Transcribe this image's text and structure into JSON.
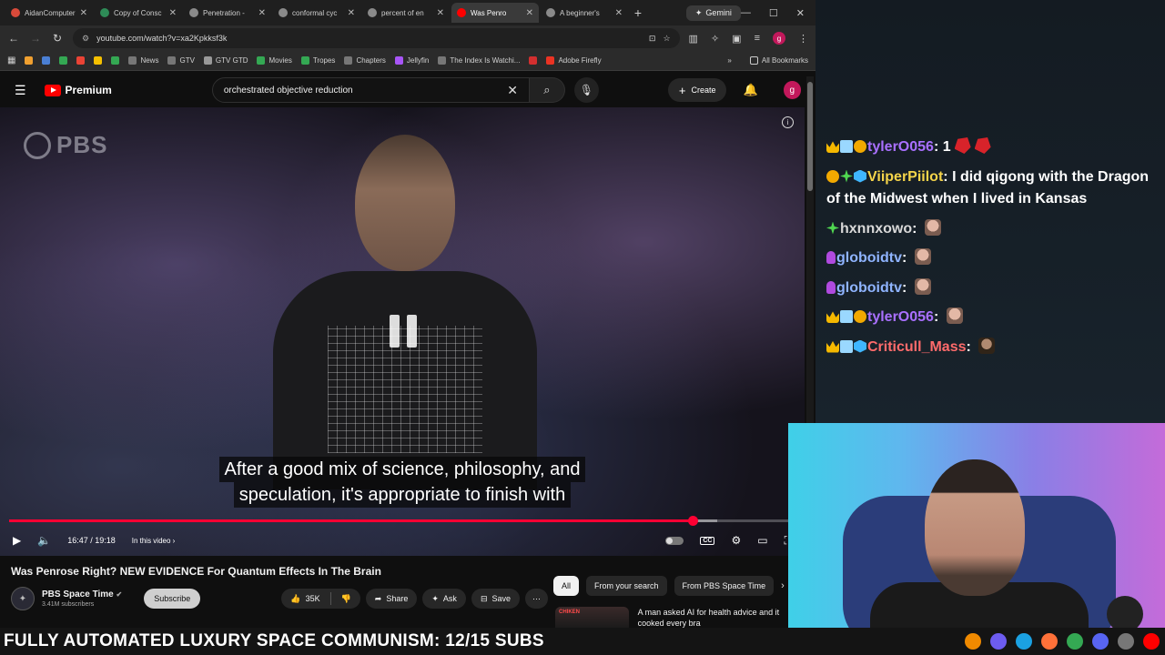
{
  "browser": {
    "tabs": [
      {
        "title": "AidanComputer",
        "color": "#d84a3a",
        "active": false
      },
      {
        "title": "Copy of Consc",
        "color": "#2e8b57",
        "active": false
      },
      {
        "title": "Penetration -",
        "color": "#8a8a8a",
        "active": false
      },
      {
        "title": "conformal cyc",
        "color": "#8a8a8a",
        "active": false
      },
      {
        "title": "percent of en",
        "color": "#8a8a8a",
        "active": false
      },
      {
        "title": "Was Penro",
        "color": "#ff0000",
        "active": true
      },
      {
        "title": "A beginner's",
        "color": "#8a8a8a",
        "active": false
      }
    ],
    "gemini_label": "Gemini",
    "url": "youtube.com/watch?v=xa2Kpkksf3k",
    "bookmarks": [
      {
        "label": "",
        "color": "#f0a030"
      },
      {
        "label": "",
        "color": "#4a7fd4"
      },
      {
        "label": "",
        "color": "#34a853"
      },
      {
        "label": "",
        "color": "#ea4335"
      },
      {
        "label": "",
        "color": "#f5c000"
      },
      {
        "label": "",
        "color": "#34a853"
      },
      {
        "label": "News",
        "color": "#777777"
      },
      {
        "label": "GTV",
        "color": "#777777"
      },
      {
        "label": "GTV GTD",
        "color": "#999999"
      },
      {
        "label": "Movies",
        "color": "#34a853"
      },
      {
        "label": "Tropes",
        "color": "#34a853"
      },
      {
        "label": "Chapters",
        "color": "#777777"
      },
      {
        "label": "Jellyfin",
        "color": "#a855f7"
      },
      {
        "label": "The Index Is Watchi...",
        "color": "#777777"
      },
      {
        "label": "",
        "color": "#d32f2f"
      },
      {
        "label": "Adobe Firefly",
        "color": "#ea3323"
      }
    ],
    "all_bookmarks": "All Bookmarks"
  },
  "youtube": {
    "logo_text": "Premium",
    "search_query": "orchestrated objective reduction",
    "create_label": "Create",
    "avatar_letter": "g"
  },
  "player": {
    "watermark": "PBS",
    "caption_line1": "After a good mix of science, philosophy, and",
    "caption_line2": "speculation, it's appropriate to finish with",
    "time": "16:47 / 19:18",
    "in_this_video": "In this video",
    "progress_played": 0.8695,
    "progress_buffered": 0.9
  },
  "video": {
    "title": "Was Penrose Right? NEW EVIDENCE For Quantum Effects In The Brain",
    "channel": "PBS Space Time",
    "subscribers": "3.41M subscribers",
    "subscribe_label": "Subscribe",
    "likes": "35K",
    "share_label": "Share",
    "ask_label": "Ask",
    "save_label": "Save"
  },
  "sidebar": {
    "chips": [
      "All",
      "From your search",
      "From PBS Space Time"
    ],
    "rec_title": "A man asked AI for health advice and it cooked every bra",
    "rec_badge": "CHIKEN"
  },
  "chat": {
    "messages": [
      {
        "badges": [
          "crown",
          "grid",
          "coin"
        ],
        "user": "tylerO056",
        "user_color": "#a970ff",
        "text": "1",
        "emotes": [
          "red",
          "red"
        ]
      },
      {
        "badges": [
          "coin",
          "green",
          "cube"
        ],
        "user": "ViiperPiilot",
        "user_color": "#f5d44a",
        "text": "I did qigong with the Dragon of the Midwest when I lived in Kansas",
        "emotes": []
      },
      {
        "badges": [
          "green"
        ],
        "user": "hxnnxowo",
        "user_color": "#d8d8d8",
        "text": "",
        "emotes": [
          "face"
        ]
      },
      {
        "badges": [
          "mic"
        ],
        "user": "globoidtv",
        "user_color": "#8fb4ff",
        "text": "",
        "emotes": [
          "face"
        ]
      },
      {
        "badges": [
          "mic"
        ],
        "user": "globoidtv",
        "user_color": "#8fb4ff",
        "text": "",
        "emotes": [
          "face"
        ]
      },
      {
        "badges": [
          "crown",
          "grid",
          "coin"
        ],
        "user": "tylerO056",
        "user_color": "#a970ff",
        "text": "",
        "emotes": [
          "face"
        ]
      },
      {
        "badges": [
          "crown",
          "grid",
          "cube"
        ],
        "user": "Criticull_Mass",
        "user_color": "#ff6b6b",
        "text": "",
        "emotes": [
          "dark"
        ]
      }
    ]
  },
  "ticker": {
    "text": "FULLY AUTOMATED LUXURY SPACE COMMUNISM: 12/15 SUBS"
  },
  "taskbar_icons": [
    {
      "name": "vlc-icon",
      "color": "#f08a00"
    },
    {
      "name": "proton-icon",
      "color": "#6d5cf0"
    },
    {
      "name": "edge-icon",
      "color": "#1ba1e2"
    },
    {
      "name": "firefox-icon",
      "color": "#ff7139"
    },
    {
      "name": "chrome-icon",
      "color": "#34a853"
    },
    {
      "name": "discord-icon",
      "color": "#5865f2"
    },
    {
      "name": "obs-icon",
      "color": "#777777"
    },
    {
      "name": "youtube-icon",
      "color": "#ff0000"
    }
  ]
}
